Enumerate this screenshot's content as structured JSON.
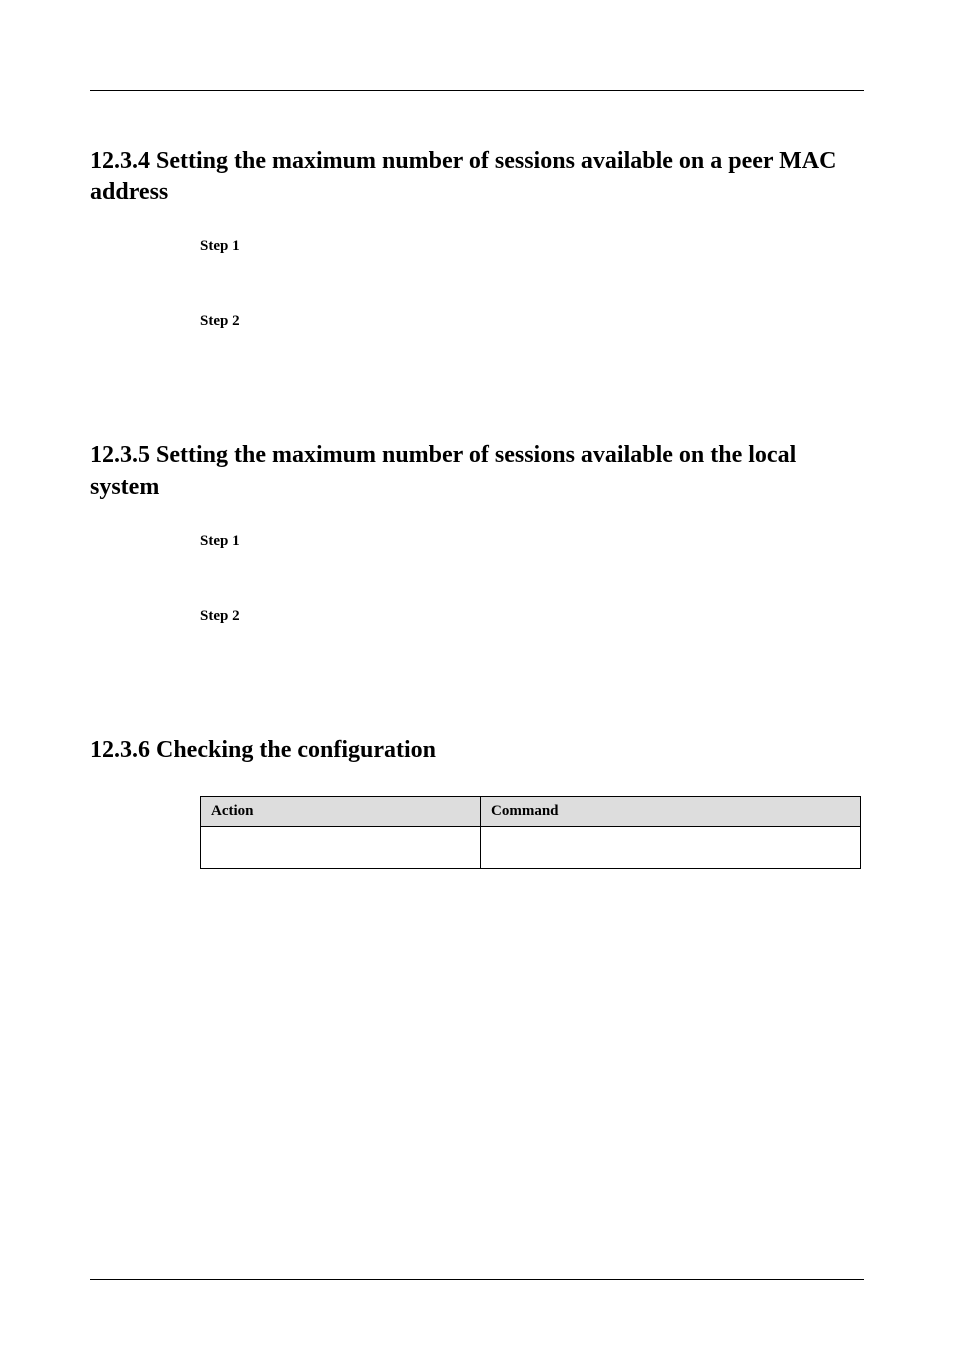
{
  "section1": {
    "heading": "12.3.4 Setting the maximum number of sessions available on a peer MAC address",
    "step1": "Step 1",
    "step2": "Step 2"
  },
  "section2": {
    "heading": "12.3.5 Setting the maximum number of sessions available on the local system",
    "step1": "Step 1",
    "step2": "Step 2"
  },
  "section3": {
    "heading": "12.3.6 Checking the configuration",
    "table": {
      "header1": "Action",
      "header2": "Command"
    }
  }
}
